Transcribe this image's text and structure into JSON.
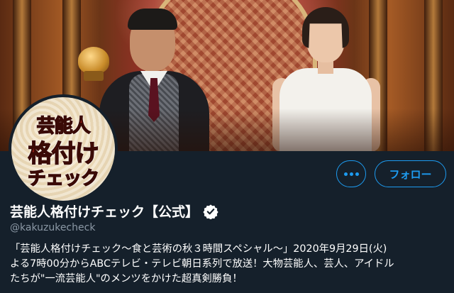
{
  "profile": {
    "display_name": "芸能人格付けチェック【公式】",
    "handle": "@kakuzukecheck",
    "bio": "「芸能人格付けチェック〜食と芸術の秋３時間スペシャル〜」2020年9月29日(火)\nよる7時00分からABCテレビ・テレビ朝日系列で放送！大物芸能人、芸人、アイドル\nたちが\"一流芸能人\"のメンツをかけた超真剣勝負！",
    "verified": true
  },
  "avatar": {
    "logo_lines": [
      "芸能人",
      "格付け",
      "チェック"
    ]
  },
  "actions": {
    "more_icon": "ellipsis-icon",
    "follow_label": "フォロー"
  },
  "colors": {
    "background": "#15202b",
    "accent": "#1d9bf0",
    "secondary_text": "#8b98a5"
  }
}
